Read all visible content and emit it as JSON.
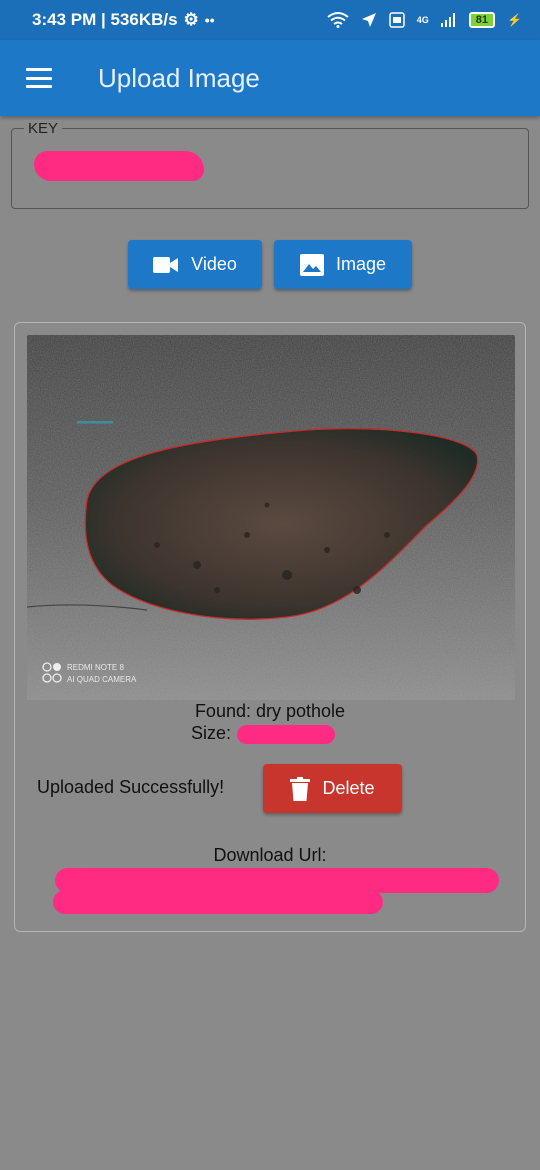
{
  "status_bar": {
    "time_speed": "3:43 PM | 536KB/s",
    "network": "4G",
    "battery": "81"
  },
  "appbar": {
    "title": "Upload Image"
  },
  "key_field": {
    "label": "KEY",
    "value": ""
  },
  "buttons": {
    "video_label": "Video",
    "image_label": "Image",
    "delete_label": "Delete"
  },
  "result": {
    "photo_watermark_line1": "REDMI NOTE 8",
    "photo_watermark_line2": "AI QUAD CAMERA",
    "found_text": "Found: dry pothole",
    "size_label": "Size:",
    "upload_status": "Uploaded Successfully!",
    "download_label": "Download Url:"
  },
  "colors": {
    "appbar": "#1e78c8",
    "primary_button": "#1e78c8",
    "delete_button": "#c7352c",
    "redaction": "#ff2b83",
    "background": "#8a8a8a"
  }
}
